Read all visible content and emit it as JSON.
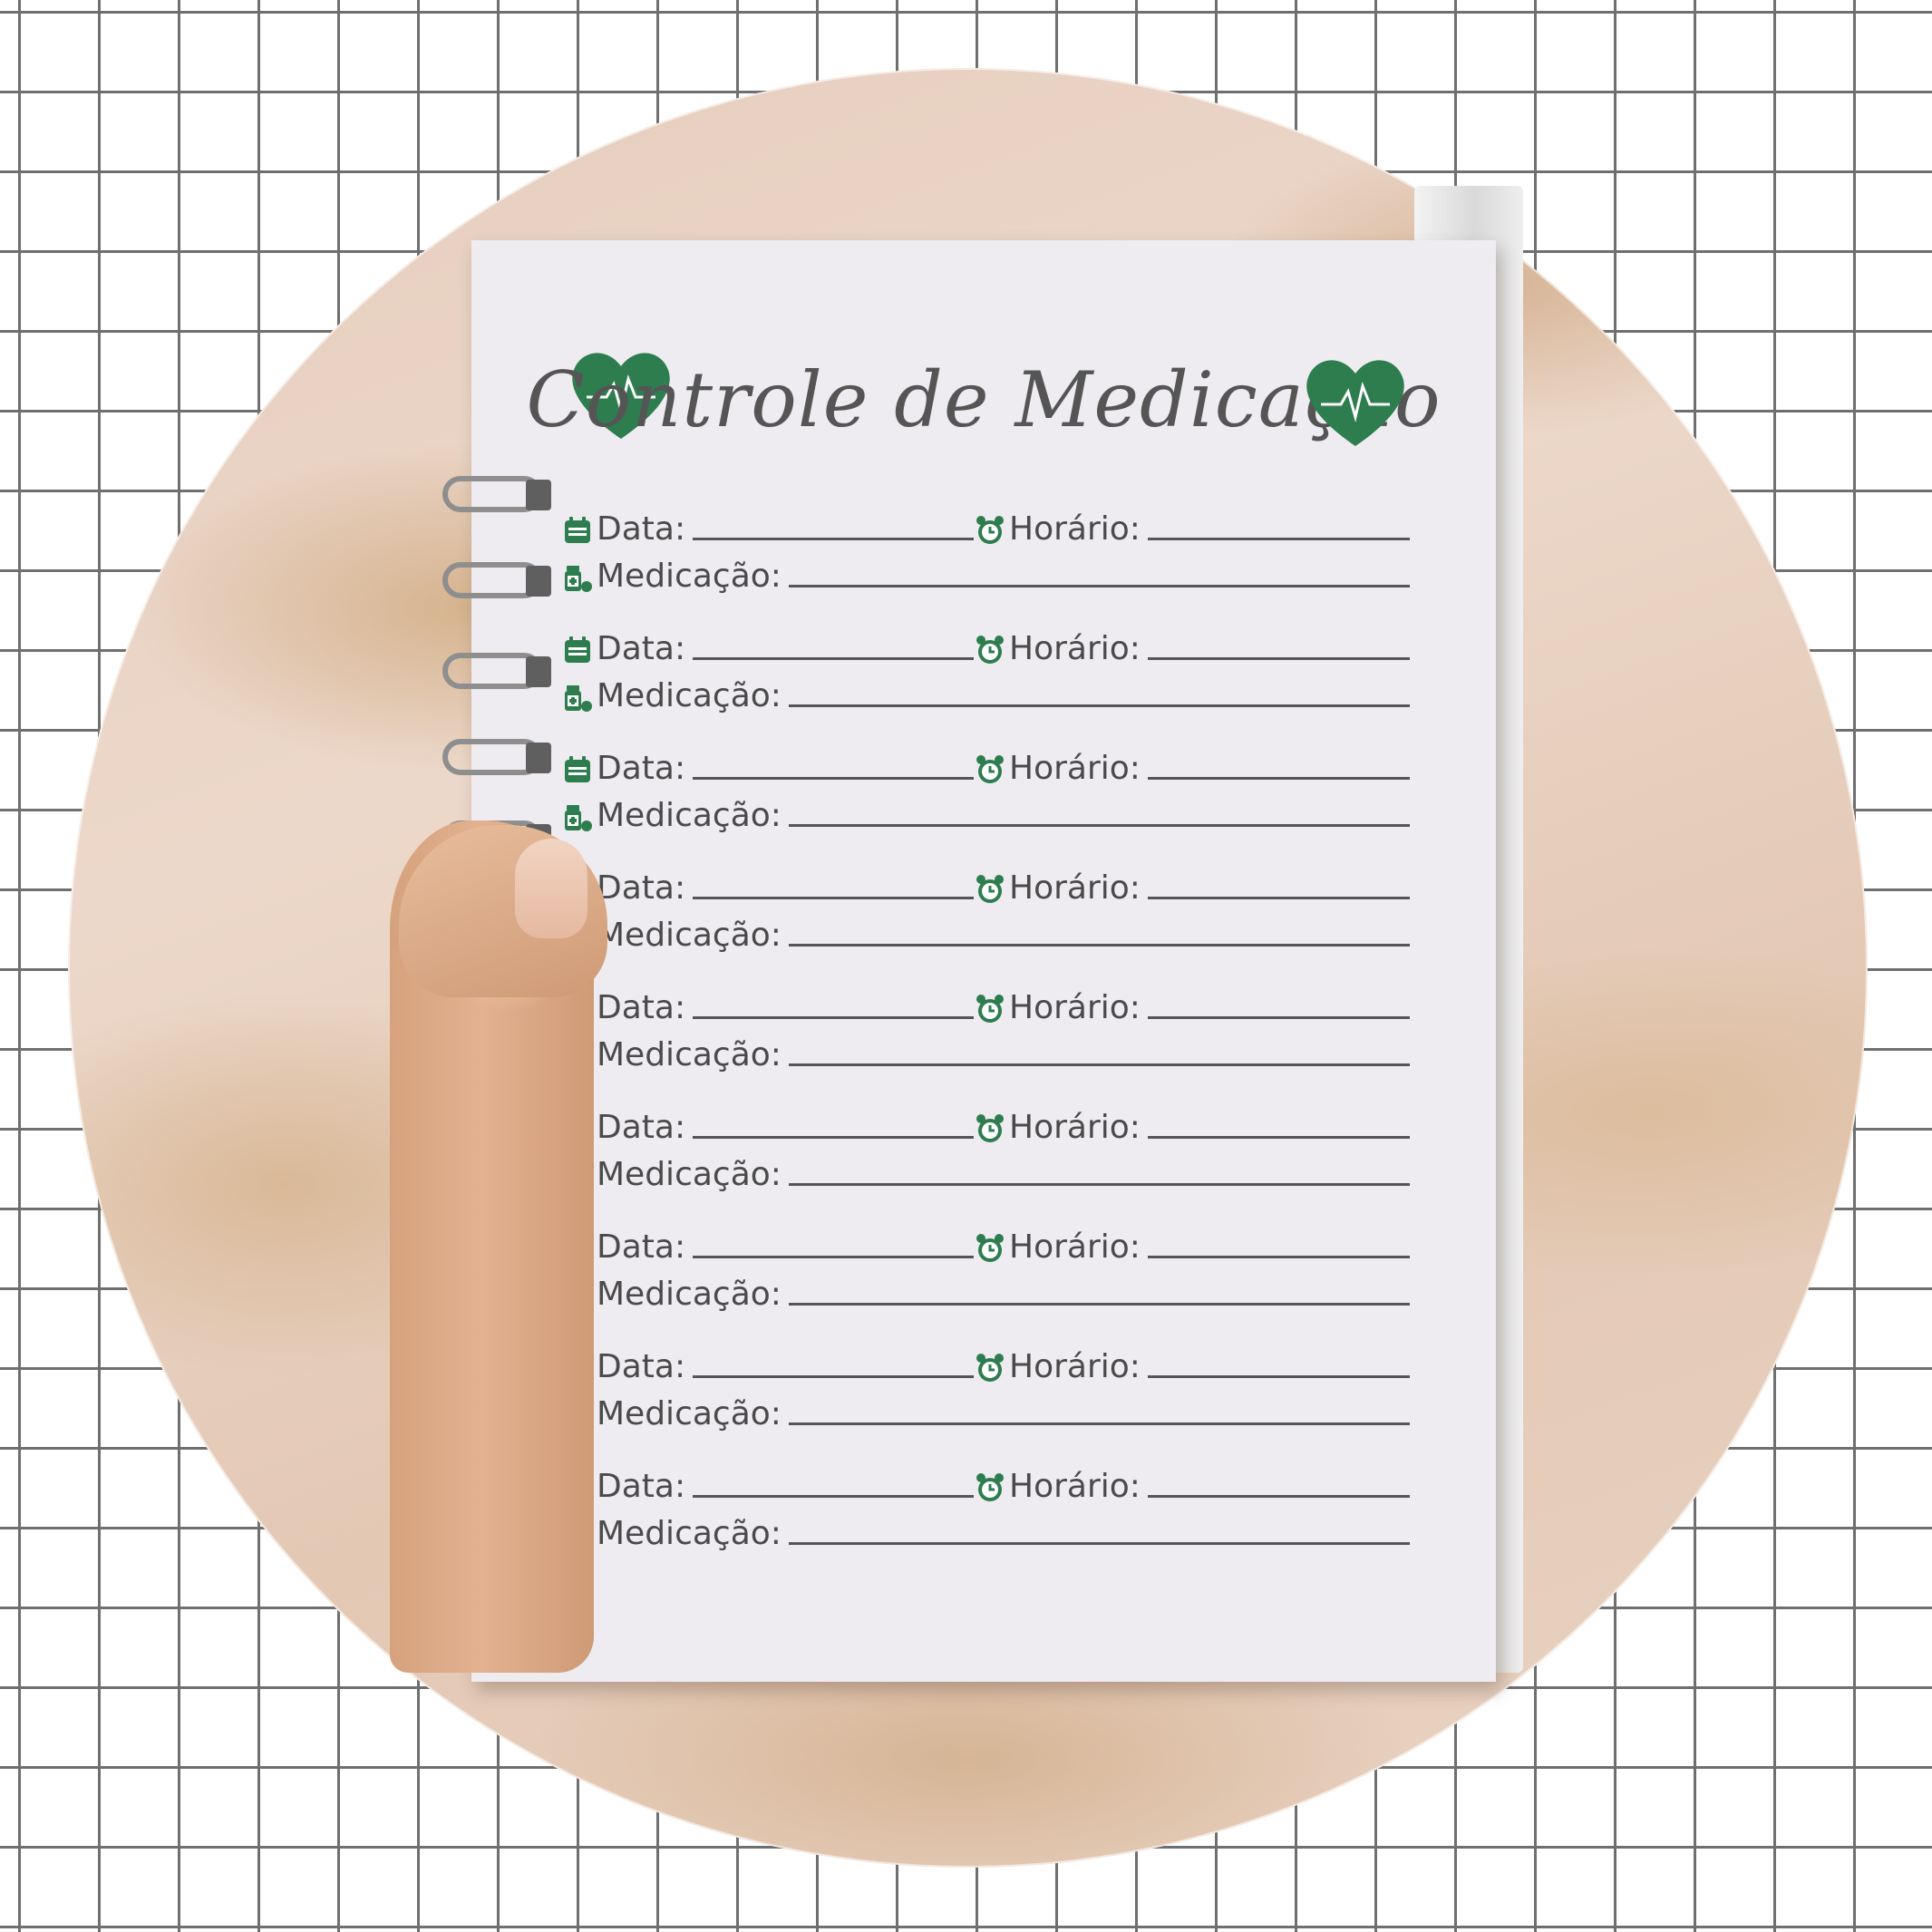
{
  "title": "Controle de Medicação",
  "icons": {
    "heart": "heart-ecg-icon",
    "date": "calendar-icon",
    "time": "alarm-clock-icon",
    "medication": "medicine-bottle-icon"
  },
  "colors": {
    "accent": "#2e7d4f",
    "text": "#4a4a4a"
  },
  "entries": [
    {
      "date_label": "Data:",
      "time_label": "Horário:",
      "med_label": "Medicação:"
    },
    {
      "date_label": "Data:",
      "time_label": "Horário:",
      "med_label": "Medicação:"
    },
    {
      "date_label": "Data:",
      "time_label": "Horário:",
      "med_label": "Medicação:"
    },
    {
      "date_label": "Data:",
      "time_label": "Horário:",
      "med_label": "Medicação:"
    },
    {
      "date_label": "Data:",
      "time_label": "Horário:",
      "med_label": "Medicação:"
    },
    {
      "date_label": "Data:",
      "time_label": "Horário:",
      "med_label": "Medicação:"
    },
    {
      "date_label": "Data:",
      "time_label": "Horário:",
      "med_label": "Medicação:"
    },
    {
      "date_label": "Data:",
      "time_label": "Horário:",
      "med_label": "Medicação:"
    },
    {
      "date_label": "Data:",
      "time_label": "Horário:",
      "med_label": "Medicação:"
    }
  ]
}
